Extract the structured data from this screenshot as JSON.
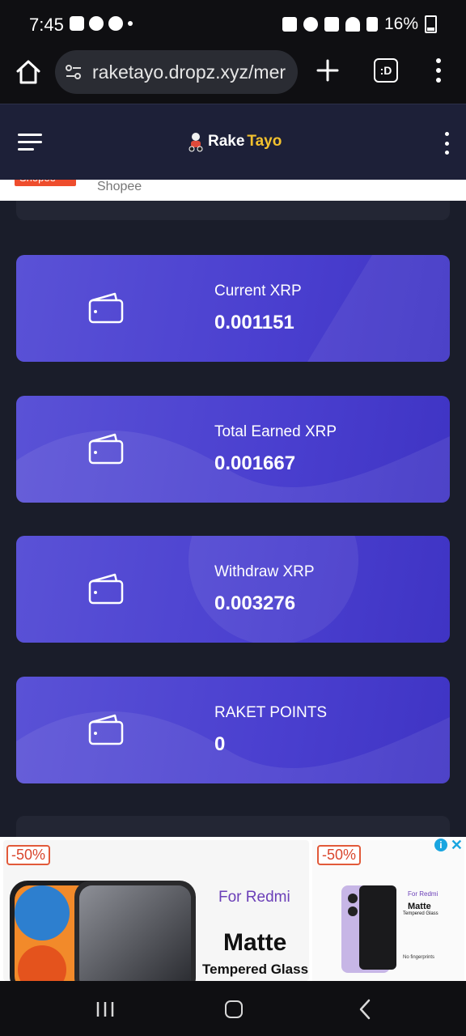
{
  "status_bar": {
    "time": "7:45",
    "battery": "16%",
    "left_icons": [
      "gallery-icon",
      "messenger-icon",
      "messenger-icon"
    ],
    "right_icons": [
      "nfc-icon",
      "alarm-icon",
      "mute-icon",
      "wifi-icon",
      "signal-icon",
      "battery-icon"
    ]
  },
  "browser": {
    "url": "raketayo.dropz.xyz/mer",
    "tab_label": ":D"
  },
  "site_header": {
    "logo_text_1": "Rake",
    "logo_text_2": "Tayo"
  },
  "strip": {
    "shopee_logo": "Shopee",
    "shopee_text": "Shopee"
  },
  "cards": [
    {
      "label": "Current XRP",
      "value": "0.001151"
    },
    {
      "label": "Total Earned XRP",
      "value": "0.001667"
    },
    {
      "label": "Withdraw XRP",
      "value": "0.003276"
    },
    {
      "label": "RAKET POINTS",
      "value": "0"
    }
  ],
  "ad": {
    "left_badge": "-50%",
    "left_for": "For Redmi",
    "left_matte": "Matte",
    "left_tg": "Tempered Glass",
    "right_badge": "-50%",
    "right_for": "For Redmi",
    "right_matte": "Matte",
    "right_tg": "Tempered Glass",
    "right_nofp": "No fingerprints",
    "info": "i"
  },
  "colors": {
    "card_gradient_start": "#5a52d6",
    "card_gradient_end": "#3f34c4",
    "page_bg": "#1a1d2a",
    "header_bg": "#1d2038",
    "logo_accent": "#f2c12e"
  }
}
